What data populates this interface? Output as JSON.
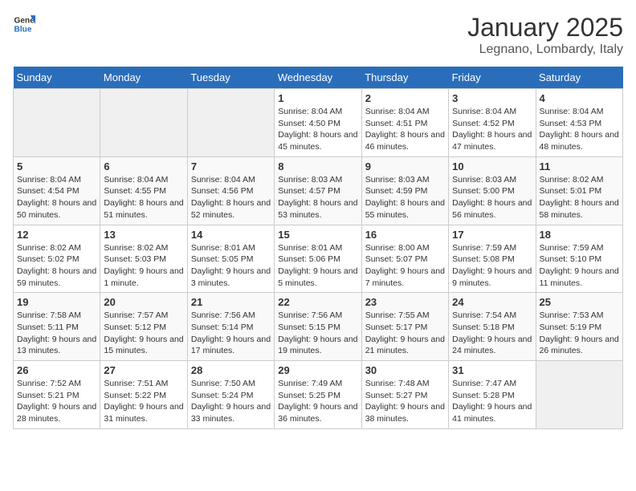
{
  "header": {
    "logo_general": "General",
    "logo_blue": "Blue",
    "title": "January 2025",
    "subtitle": "Legnano, Lombardy, Italy"
  },
  "weekdays": [
    "Sunday",
    "Monday",
    "Tuesday",
    "Wednesday",
    "Thursday",
    "Friday",
    "Saturday"
  ],
  "weeks": [
    [
      {
        "day": "",
        "info": ""
      },
      {
        "day": "",
        "info": ""
      },
      {
        "day": "",
        "info": ""
      },
      {
        "day": "1",
        "info": "Sunrise: 8:04 AM\nSunset: 4:50 PM\nDaylight: 8 hours and 45 minutes."
      },
      {
        "day": "2",
        "info": "Sunrise: 8:04 AM\nSunset: 4:51 PM\nDaylight: 8 hours and 46 minutes."
      },
      {
        "day": "3",
        "info": "Sunrise: 8:04 AM\nSunset: 4:52 PM\nDaylight: 8 hours and 47 minutes."
      },
      {
        "day": "4",
        "info": "Sunrise: 8:04 AM\nSunset: 4:53 PM\nDaylight: 8 hours and 48 minutes."
      }
    ],
    [
      {
        "day": "5",
        "info": "Sunrise: 8:04 AM\nSunset: 4:54 PM\nDaylight: 8 hours and 50 minutes."
      },
      {
        "day": "6",
        "info": "Sunrise: 8:04 AM\nSunset: 4:55 PM\nDaylight: 8 hours and 51 minutes."
      },
      {
        "day": "7",
        "info": "Sunrise: 8:04 AM\nSunset: 4:56 PM\nDaylight: 8 hours and 52 minutes."
      },
      {
        "day": "8",
        "info": "Sunrise: 8:03 AM\nSunset: 4:57 PM\nDaylight: 8 hours and 53 minutes."
      },
      {
        "day": "9",
        "info": "Sunrise: 8:03 AM\nSunset: 4:59 PM\nDaylight: 8 hours and 55 minutes."
      },
      {
        "day": "10",
        "info": "Sunrise: 8:03 AM\nSunset: 5:00 PM\nDaylight: 8 hours and 56 minutes."
      },
      {
        "day": "11",
        "info": "Sunrise: 8:02 AM\nSunset: 5:01 PM\nDaylight: 8 hours and 58 minutes."
      }
    ],
    [
      {
        "day": "12",
        "info": "Sunrise: 8:02 AM\nSunset: 5:02 PM\nDaylight: 8 hours and 59 minutes."
      },
      {
        "day": "13",
        "info": "Sunrise: 8:02 AM\nSunset: 5:03 PM\nDaylight: 9 hours and 1 minute."
      },
      {
        "day": "14",
        "info": "Sunrise: 8:01 AM\nSunset: 5:05 PM\nDaylight: 9 hours and 3 minutes."
      },
      {
        "day": "15",
        "info": "Sunrise: 8:01 AM\nSunset: 5:06 PM\nDaylight: 9 hours and 5 minutes."
      },
      {
        "day": "16",
        "info": "Sunrise: 8:00 AM\nSunset: 5:07 PM\nDaylight: 9 hours and 7 minutes."
      },
      {
        "day": "17",
        "info": "Sunrise: 7:59 AM\nSunset: 5:08 PM\nDaylight: 9 hours and 9 minutes."
      },
      {
        "day": "18",
        "info": "Sunrise: 7:59 AM\nSunset: 5:10 PM\nDaylight: 9 hours and 11 minutes."
      }
    ],
    [
      {
        "day": "19",
        "info": "Sunrise: 7:58 AM\nSunset: 5:11 PM\nDaylight: 9 hours and 13 minutes."
      },
      {
        "day": "20",
        "info": "Sunrise: 7:57 AM\nSunset: 5:12 PM\nDaylight: 9 hours and 15 minutes."
      },
      {
        "day": "21",
        "info": "Sunrise: 7:56 AM\nSunset: 5:14 PM\nDaylight: 9 hours and 17 minutes."
      },
      {
        "day": "22",
        "info": "Sunrise: 7:56 AM\nSunset: 5:15 PM\nDaylight: 9 hours and 19 minutes."
      },
      {
        "day": "23",
        "info": "Sunrise: 7:55 AM\nSunset: 5:17 PM\nDaylight: 9 hours and 21 minutes."
      },
      {
        "day": "24",
        "info": "Sunrise: 7:54 AM\nSunset: 5:18 PM\nDaylight: 9 hours and 24 minutes."
      },
      {
        "day": "25",
        "info": "Sunrise: 7:53 AM\nSunset: 5:19 PM\nDaylight: 9 hours and 26 minutes."
      }
    ],
    [
      {
        "day": "26",
        "info": "Sunrise: 7:52 AM\nSunset: 5:21 PM\nDaylight: 9 hours and 28 minutes."
      },
      {
        "day": "27",
        "info": "Sunrise: 7:51 AM\nSunset: 5:22 PM\nDaylight: 9 hours and 31 minutes."
      },
      {
        "day": "28",
        "info": "Sunrise: 7:50 AM\nSunset: 5:24 PM\nDaylight: 9 hours and 33 minutes."
      },
      {
        "day": "29",
        "info": "Sunrise: 7:49 AM\nSunset: 5:25 PM\nDaylight: 9 hours and 36 minutes."
      },
      {
        "day": "30",
        "info": "Sunrise: 7:48 AM\nSunset: 5:27 PM\nDaylight: 9 hours and 38 minutes."
      },
      {
        "day": "31",
        "info": "Sunrise: 7:47 AM\nSunset: 5:28 PM\nDaylight: 9 hours and 41 minutes."
      },
      {
        "day": "",
        "info": ""
      }
    ]
  ]
}
